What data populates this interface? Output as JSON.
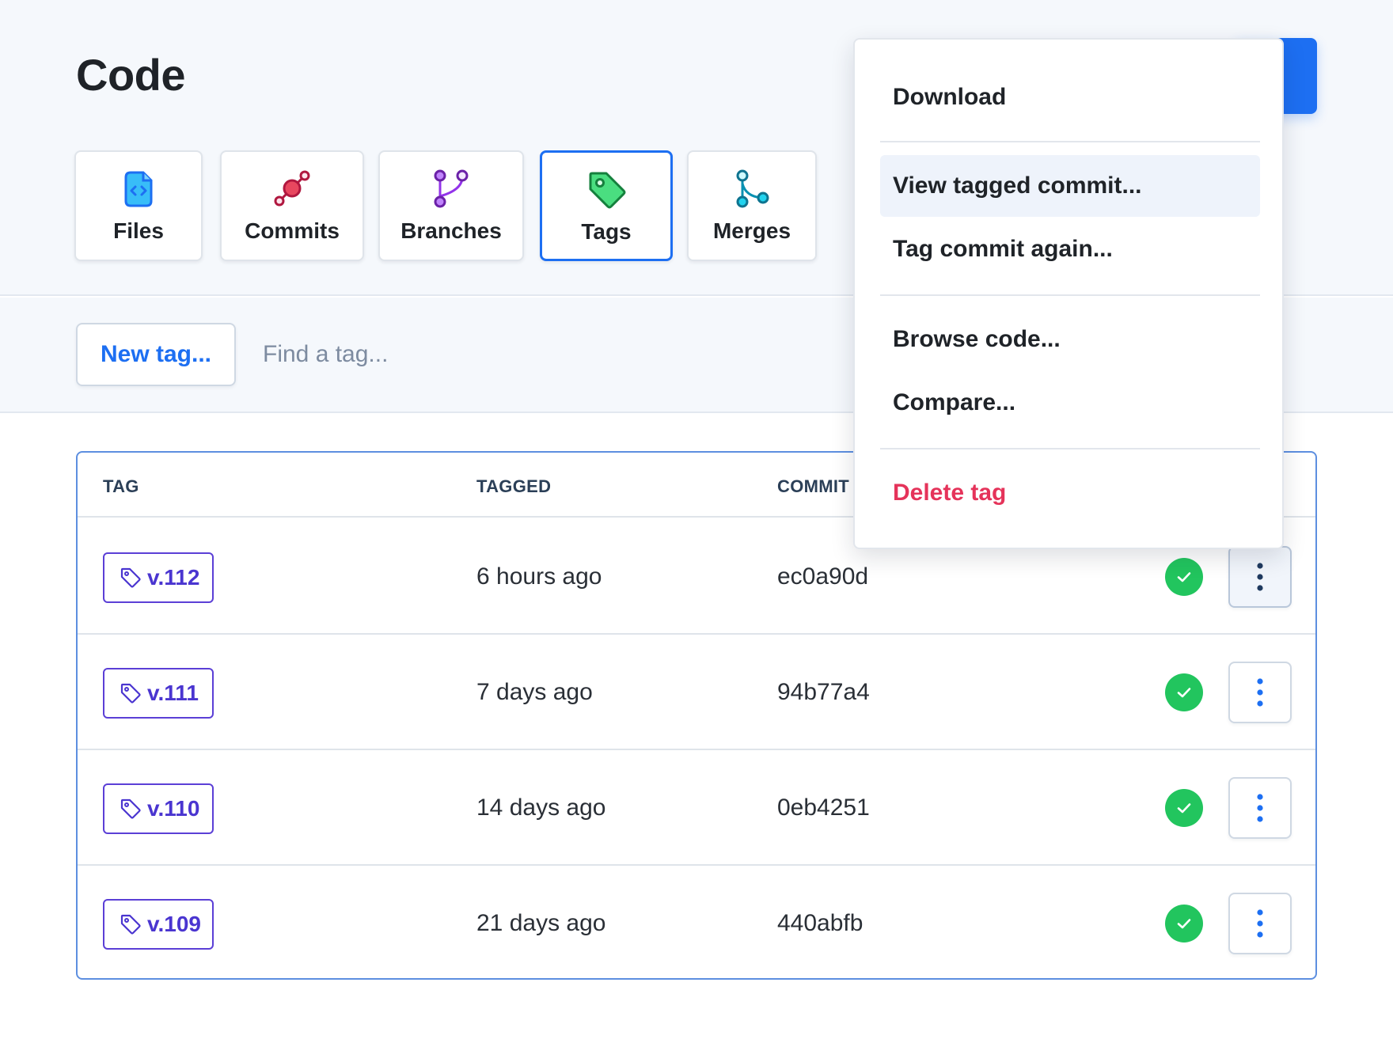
{
  "page": {
    "title": "Code"
  },
  "tabs": [
    {
      "label": "Files",
      "icon": "file-code-icon"
    },
    {
      "label": "Commits",
      "icon": "commit-icon"
    },
    {
      "label": "Branches",
      "icon": "branch-icon"
    },
    {
      "label": "Tags",
      "icon": "tag-icon",
      "active": true
    },
    {
      "label": "Merges",
      "icon": "merge-icon"
    }
  ],
  "toolbar": {
    "new_tag_label": "New tag...",
    "search_placeholder": "Find a tag..."
  },
  "table": {
    "headers": {
      "tag": "TAG",
      "tagged": "TAGGED",
      "commit": "COMMIT"
    },
    "rows": [
      {
        "tag": "v.112",
        "tagged": "6 hours ago",
        "commit": "ec0a90d",
        "status": "success"
      },
      {
        "tag": "v.111",
        "tagged": "7 days ago",
        "commit": "94b77a4",
        "status": "success"
      },
      {
        "tag": "v.110",
        "tagged": "14 days ago",
        "commit": "0eb4251",
        "status": "success"
      },
      {
        "tag": "v.109",
        "tagged": "21 days ago",
        "commit": "440abfb",
        "status": "success"
      }
    ]
  },
  "menu": {
    "items": [
      {
        "label": "Download"
      },
      {
        "label": "View tagged commit..."
      },
      {
        "label": "Tag commit again..."
      },
      {
        "label": "Browse code..."
      },
      {
        "label": "Compare..."
      },
      {
        "label": "Delete tag"
      }
    ]
  },
  "colors": {
    "accent": "#1d6ff2",
    "tag": "#4a35d0",
    "success": "#22c55e",
    "danger": "#e5335a"
  }
}
